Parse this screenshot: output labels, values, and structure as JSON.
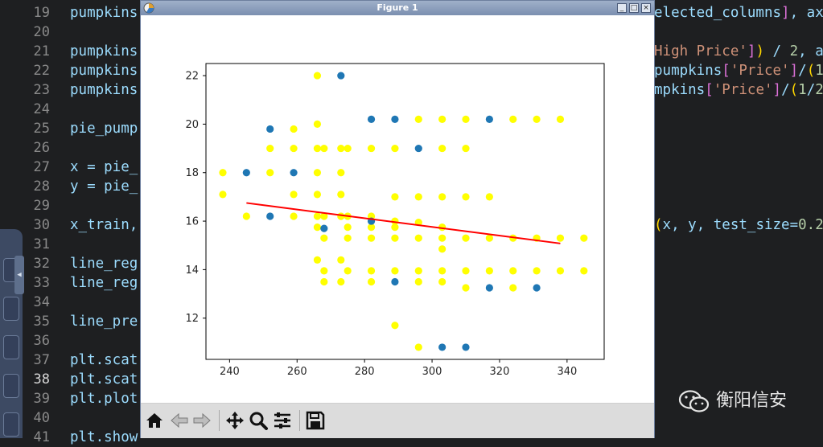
{
  "editor": {
    "lines": [
      {
        "num": "19",
        "left": "pumpkins",
        "right": "elected_columns], ax"
      },
      {
        "num": "20",
        "left": "",
        "right": ""
      },
      {
        "num": "21",
        "left": "pumpkins",
        "right": "High Price']) / 2, a"
      },
      {
        "num": "22",
        "left": "pumpkins",
        "right": "pumpkins['Price']/(1"
      },
      {
        "num": "23",
        "left": "pumpkins",
        "right": "mpkins['Price']/(1/2"
      },
      {
        "num": "24",
        "left": "",
        "right": ""
      },
      {
        "num": "25",
        "left": "pie_pump",
        "right": ""
      },
      {
        "num": "26",
        "left": "",
        "right": ""
      },
      {
        "num": "27",
        "left": "x = pie_",
        "right": ""
      },
      {
        "num": "28",
        "left": "y = pie_",
        "right": ""
      },
      {
        "num": "29",
        "left": "",
        "right": ""
      },
      {
        "num": "30",
        "left": "x_train,",
        "right": "(x, y, test_size=0.2"
      },
      {
        "num": "31",
        "left": "",
        "right": ""
      },
      {
        "num": "32",
        "left": "line_reg",
        "right": ""
      },
      {
        "num": "33",
        "left": "line_reg",
        "right": ""
      },
      {
        "num": "34",
        "left": "",
        "right": ""
      },
      {
        "num": "35",
        "left": "line_pre",
        "right": ""
      },
      {
        "num": "36",
        "left": "",
        "right": ""
      },
      {
        "num": "37",
        "left": "plt.scat",
        "right": ""
      },
      {
        "num": "38",
        "left": "plt.scat",
        "right": ""
      },
      {
        "num": "39",
        "left": "plt.plot",
        "right": ""
      },
      {
        "num": "40",
        "left": "",
        "right": ""
      },
      {
        "num": "41",
        "left": "plt.show",
        "right": ""
      }
    ],
    "current_line": "38"
  },
  "figure": {
    "title": "Figure 1",
    "buttons": {
      "minimize": "_",
      "maximize": "□",
      "close": "×"
    },
    "toolbar_icons": [
      "home-icon",
      "back-icon",
      "forward-icon",
      "pan-icon",
      "zoom-icon",
      "configure-icon",
      "save-icon"
    ]
  },
  "watermark": {
    "text": "衡阳信安"
  },
  "colors": {
    "blue": "#1f77b4",
    "yellow": "#ffff00",
    "red": "#ff0000",
    "editor_bg": "#1e1f21"
  },
  "chart_data": {
    "type": "scatter",
    "title": "",
    "xlabel": "",
    "ylabel": "",
    "xlim": [
      233,
      351
    ],
    "ylim": [
      10.3,
      22.5
    ],
    "xticks": [
      240,
      260,
      280,
      300,
      320,
      340
    ],
    "yticks": [
      12,
      14,
      16,
      18,
      20,
      22
    ],
    "grid": false,
    "series": [
      {
        "color": "#1f77b4",
        "kind": "scatter",
        "points": [
          [
            273,
            22.0
          ],
          [
            252,
            19.8
          ],
          [
            245,
            18.0
          ],
          [
            259,
            18.0
          ],
          [
            282,
            20.2
          ],
          [
            289,
            20.2
          ],
          [
            317,
            20.2
          ],
          [
            296,
            19.0
          ],
          [
            252,
            16.2
          ],
          [
            268,
            15.7
          ],
          [
            282,
            16.0
          ],
          [
            289,
            13.5
          ],
          [
            317,
            13.25
          ],
          [
            331,
            13.25
          ],
          [
            303,
            10.8
          ],
          [
            310,
            10.8
          ]
        ]
      },
      {
        "color": "#ffff00",
        "kind": "scatter",
        "points": [
          [
            266,
            22.0
          ],
          [
            259,
            19.8
          ],
          [
            266,
            20.0
          ],
          [
            252,
            19.0
          ],
          [
            259,
            19.0
          ],
          [
            266,
            19.0
          ],
          [
            268,
            19.0
          ],
          [
            273,
            19.0
          ],
          [
            275,
            19.0
          ],
          [
            282,
            19.0
          ],
          [
            289,
            19.0
          ],
          [
            303,
            19.0
          ],
          [
            310,
            19.0
          ],
          [
            296,
            20.2
          ],
          [
            303,
            20.2
          ],
          [
            310,
            20.2
          ],
          [
            324,
            20.2
          ],
          [
            331,
            20.2
          ],
          [
            338,
            20.2
          ],
          [
            238,
            18.0
          ],
          [
            252,
            18.0
          ],
          [
            266,
            18.0
          ],
          [
            273,
            18.0
          ],
          [
            238,
            17.1
          ],
          [
            259,
            17.1
          ],
          [
            266,
            17.1
          ],
          [
            273,
            17.1
          ],
          [
            289,
            17.0
          ],
          [
            296,
            17.0
          ],
          [
            303,
            17.0
          ],
          [
            310,
            17.0
          ],
          [
            317,
            17.0
          ],
          [
            245,
            16.2
          ],
          [
            259,
            16.2
          ],
          [
            266,
            16.2
          ],
          [
            268,
            16.2
          ],
          [
            273,
            16.2
          ],
          [
            275,
            16.2
          ],
          [
            282,
            16.2
          ],
          [
            289,
            16.0
          ],
          [
            296,
            15.95
          ],
          [
            266,
            15.75
          ],
          [
            275,
            15.75
          ],
          [
            282,
            15.75
          ],
          [
            289,
            15.75
          ],
          [
            303,
            15.75
          ],
          [
            268,
            15.3
          ],
          [
            275,
            15.3
          ],
          [
            282,
            15.3
          ],
          [
            289,
            15.3
          ],
          [
            296,
            15.3
          ],
          [
            303,
            15.3
          ],
          [
            310,
            15.3
          ],
          [
            317,
            15.3
          ],
          [
            324,
            15.3
          ],
          [
            331,
            15.3
          ],
          [
            338,
            15.3
          ],
          [
            345,
            15.3
          ],
          [
            303,
            14.85
          ],
          [
            266,
            14.4
          ],
          [
            273,
            14.4
          ],
          [
            268,
            13.95
          ],
          [
            275,
            13.95
          ],
          [
            282,
            13.95
          ],
          [
            289,
            13.95
          ],
          [
            296,
            13.95
          ],
          [
            303,
            13.95
          ],
          [
            310,
            13.95
          ],
          [
            317,
            13.95
          ],
          [
            324,
            13.95
          ],
          [
            331,
            13.95
          ],
          [
            338,
            13.95
          ],
          [
            345,
            13.95
          ],
          [
            268,
            13.5
          ],
          [
            273,
            13.5
          ],
          [
            282,
            13.5
          ],
          [
            296,
            13.5
          ],
          [
            303,
            13.5
          ],
          [
            310,
            13.25
          ],
          [
            324,
            13.25
          ],
          [
            289,
            11.7
          ],
          [
            296,
            10.8
          ]
        ]
      },
      {
        "color": "#ff0000",
        "kind": "line",
        "points": [
          [
            245,
            16.75
          ],
          [
            338,
            15.08
          ]
        ]
      }
    ]
  }
}
